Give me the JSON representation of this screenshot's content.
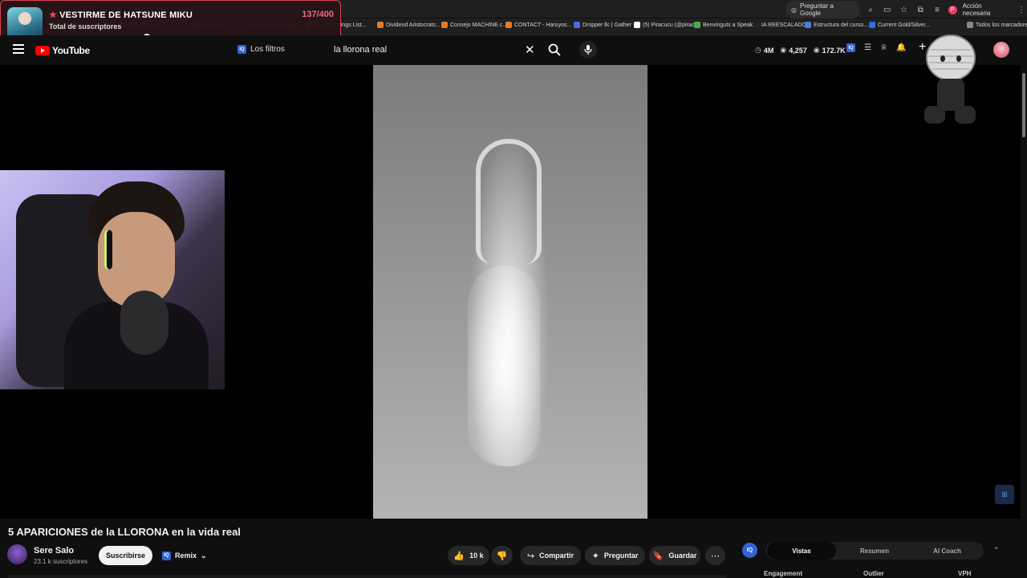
{
  "browser": {
    "ask_google": "Preguntar a Google",
    "action_needed": "Acción necesaria",
    "profile_initial": "P",
    "bookmarks": [
      {
        "label": "Reacciones",
        "color": "#555555"
      },
      {
        "label": "Patreon Vibes",
        "color": "#555555"
      },
      {
        "label": "Dividendos",
        "color": "#666666"
      },
      {
        "label": "Apoya a mi creador",
        "color": "#555555"
      },
      {
        "label": "Dividend Kings List...",
        "color": "#e57a2a"
      },
      {
        "label": "Dividend Aristocrats...",
        "color": "#e57a2a"
      },
      {
        "label": "Consejo MACHINE.c...",
        "color": "#e57a2a"
      },
      {
        "label": "CONTACT - Haruyos...",
        "color": "#e57a2a"
      },
      {
        "label": "Dropper llc | Gather",
        "color": "#4a6ce0"
      },
      {
        "label": "(5) Piracucu (@pirac...",
        "color": "#ffffff"
      },
      {
        "label": "Benvinguts a Speak...",
        "color": "#4fa84f"
      },
      {
        "label": "IA REESCALADO",
        "color": "#222222"
      },
      {
        "label": "Estructura del curso...",
        "color": "#4a7de0"
      },
      {
        "label": "Current Gold/Silver...",
        "color": "#2f6de0"
      },
      {
        "label": "Todos los marcadores",
        "color": "#888888"
      }
    ]
  },
  "overlay": {
    "title": "VESTIRME DE HATSUNE MIKU",
    "count": "137/400",
    "subtitle": "Total de suscriptores",
    "progress": 0.3425
  },
  "header": {
    "logo": "YouTube",
    "filters_label": "Los filtros",
    "search_value": "la llorona real",
    "stats": [
      {
        "icon": "clock-icon",
        "value": "4M"
      },
      {
        "icon": "eye-icon",
        "value": "4,257"
      },
      {
        "icon": "eye-icon",
        "value": "172.7K"
      }
    ]
  },
  "video": {
    "title": "5 APARICIONES de la LLORONA en la vida real",
    "channel": "Sere Salo",
    "subscribers": "23.1 k suscriptores",
    "subscribe": "Suscribirse",
    "remix": "Remix",
    "likes": "10 k",
    "share": "Compartir",
    "ask": "Preguntar",
    "save": "Guardar"
  },
  "side_panel": {
    "badge": "IQ",
    "tabs": [
      "Vistas",
      "Resumen",
      "AI Coach"
    ],
    "active_tab": "Vistas",
    "columns": [
      "Engagement",
      "Outlier",
      "VPH"
    ]
  },
  "colors": {
    "accent": "#e14b5e",
    "youtube_red": "#ff0000",
    "iq_blue": "#3262d6",
    "background": "#0f0f0f"
  }
}
